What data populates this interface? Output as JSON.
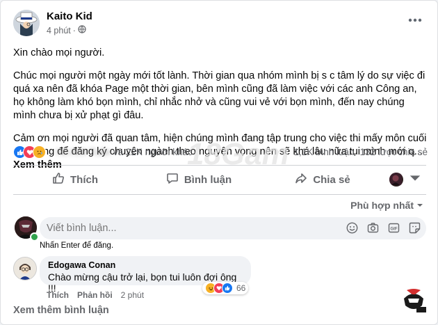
{
  "post": {
    "author": "Kaito Kid",
    "time": "4 phút",
    "privacy_icon": "globe-icon",
    "paragraphs": [
      "Xin chào mọi người.",
      "Chúc mọi người một ngày mới tốt lành. Thời gian qua nhóm mình bị s c tâm lý do sự việc đi quá xa nên đã khóa Page một thời gian, bên mình cũng đã làm việc với các anh Công an, họ không làm khó bọn mình, chỉ nhắc nhở và cũng vui vẻ với bọn mình, đến nay chúng mình chưa bị xử phạt gì đâu.",
      "Cảm ơn mọi người đã quan tâm, hiện chúng mình đang tập trung cho việc thi mấy môn cuối cho xong để đăng ký chuyên ngành theo nguyện vọng nên sẽ khá lâu nữa tụi mình mới q..."
    ],
    "see_more": "Xem thêm"
  },
  "stats": {
    "reaction_icons": [
      "like-icon",
      "love-icon",
      "sad-icon"
    ],
    "blurred_name": "Hồ Anh Tuấn",
    "others": "và 22K người khác",
    "comments": "1,1K bình luận",
    "shares": "132 lượt chia sẻ"
  },
  "actions": {
    "like": "Thích",
    "comment": "Bình luận",
    "share": "Chia sẻ"
  },
  "sort_label": "Phù hợp nhất",
  "composer": {
    "placeholder": "Viết bình luận...",
    "hint": "Nhấn Enter để đăng."
  },
  "comment": {
    "author": "Edogawa Conan",
    "text": "Chào mừng cậu trở lại, bọn tui luôn đợi ông !!!",
    "like": "Thích",
    "reply": "Phản hồi",
    "time": "2 phút",
    "reaction_count": "66"
  },
  "more_comments": "Xem thêm bình luận",
  "watermark": "18Gam",
  "colors": {
    "like_blue": "#1877f2",
    "love_red": "#f33e58",
    "haha_yellow": "#f7b125",
    "text_secondary": "#65676b"
  }
}
